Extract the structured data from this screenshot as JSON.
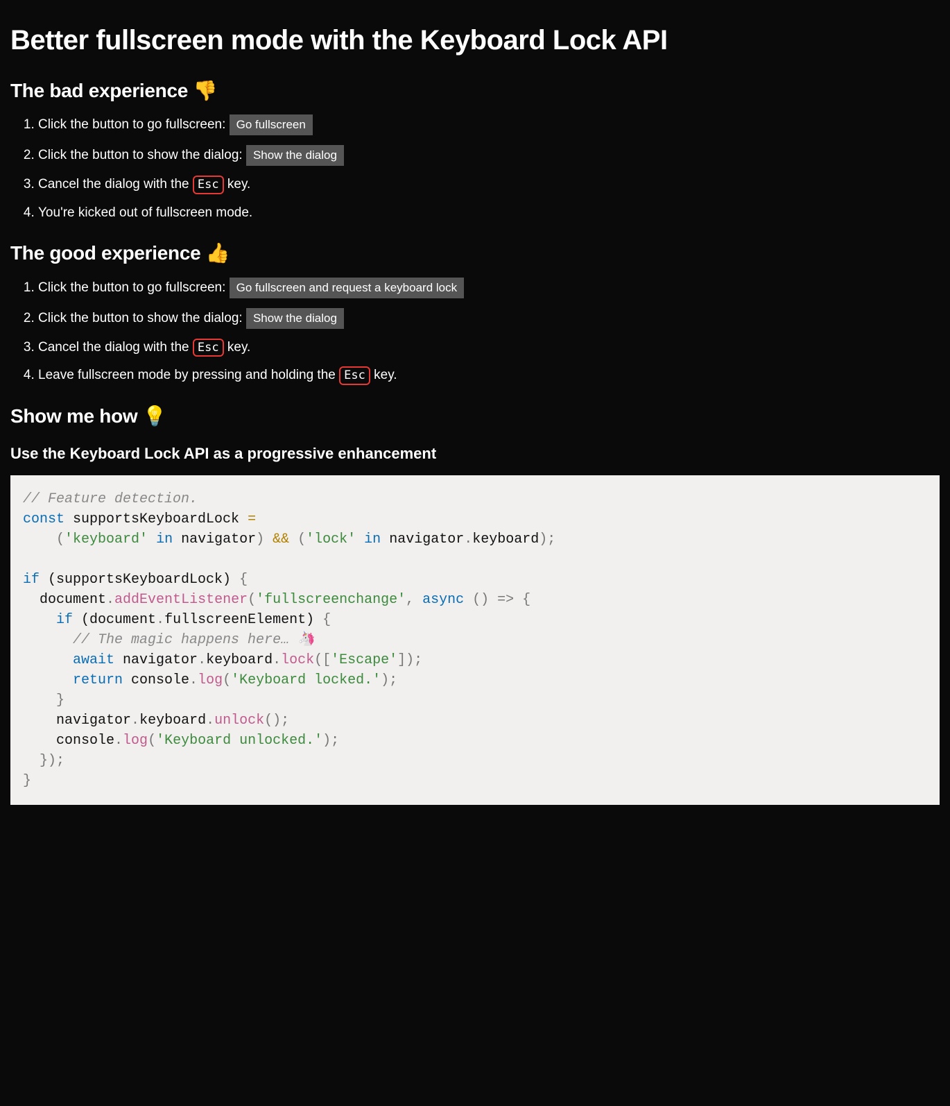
{
  "title": "Better fullscreen mode with the Keyboard Lock API",
  "bad": {
    "heading": "The bad experience 👎",
    "steps": {
      "s1_text": "Click the button to go fullscreen: ",
      "s1_button": "Go fullscreen",
      "s2_text": "Click the button to show the dialog: ",
      "s2_button": "Show the dialog",
      "s3_prefix": "Cancel the dialog with the ",
      "s3_key": "Esc",
      "s3_suffix": " key.",
      "s4_text": "You're kicked out of fullscreen mode."
    }
  },
  "good": {
    "heading": "The good experience 👍",
    "steps": {
      "s1_text": "Click the button to go fullscreen: ",
      "s1_button": "Go fullscreen and request a keyboard lock",
      "s2_text": "Click the button to show the dialog: ",
      "s2_button": "Show the dialog",
      "s3_prefix": "Cancel the dialog with the ",
      "s3_key": "Esc",
      "s3_suffix": " key.",
      "s4_prefix": "Leave fullscreen mode by pressing and holding the ",
      "s4_key": "Esc",
      "s4_suffix": " key."
    }
  },
  "how": {
    "heading": "Show me how 💡",
    "subheading": "Use the Keyboard Lock API as a progressive enhancement"
  },
  "code": {
    "l1": "// Feature detection.",
    "l2_const": "const",
    "l2_rest": " supportsKeyboardLock ",
    "l2_eq": "=",
    "l3_indent": "    ",
    "l3_p1": "(",
    "l3_s1": "'keyboard'",
    "l3_in1": " in ",
    "l3_nav1": "navigator",
    "l3_p2": ")",
    "l3_and": " && ",
    "l3_p3": "(",
    "l3_s2": "'lock'",
    "l3_in2": " in ",
    "l3_nav2": "navigator",
    "l3_dot": ".",
    "l3_kb": "keyboard",
    "l3_p4": ");",
    "l5_if": "if",
    "l5_rest": " (supportsKeyboardLock) ",
    "l5_brace": "{",
    "l6_indent": "  ",
    "l6_doc": "document",
    "l6_dot": ".",
    "l6_add": "addEventListener",
    "l6_p1": "(",
    "l6_str": "'fullscreenchange'",
    "l6_comma": ", ",
    "l6_async": "async",
    "l6_arrow": " () => {",
    "l7_indent": "    ",
    "l7_if": "if",
    "l7_rest": " (document",
    "l7_dot": ".",
    "l7_fe": "fullscreenElement) ",
    "l7_brace": "{",
    "l8_indent": "      ",
    "l8_comment": "// The magic happens here… 🦄",
    "l9_indent": "      ",
    "l9_await": "await",
    "l9_sp": " navigator",
    "l9_dot1": ".",
    "l9_kb": "keyboard",
    "l9_dot2": ".",
    "l9_lock": "lock",
    "l9_p1": "([",
    "l9_str": "'Escape'",
    "l9_p2": "]);",
    "l10_indent": "      ",
    "l10_return": "return",
    "l10_sp": " console",
    "l10_dot": ".",
    "l10_log": "log",
    "l10_p1": "(",
    "l10_str": "'Keyboard locked.'",
    "l10_p2": ");",
    "l11_indent": "    ",
    "l11_brace": "}",
    "l12_indent": "    ",
    "l12_nav": "navigator",
    "l12_dot1": ".",
    "l12_kb": "keyboard",
    "l12_dot2": ".",
    "l12_unlock": "unlock",
    "l12_p": "();",
    "l13_indent": "    ",
    "l13_console": "console",
    "l13_dot": ".",
    "l13_log": "log",
    "l13_p1": "(",
    "l13_str": "'Keyboard unlocked.'",
    "l13_p2": ");",
    "l14_indent": "  ",
    "l14_close": "});",
    "l15_close": "}"
  }
}
